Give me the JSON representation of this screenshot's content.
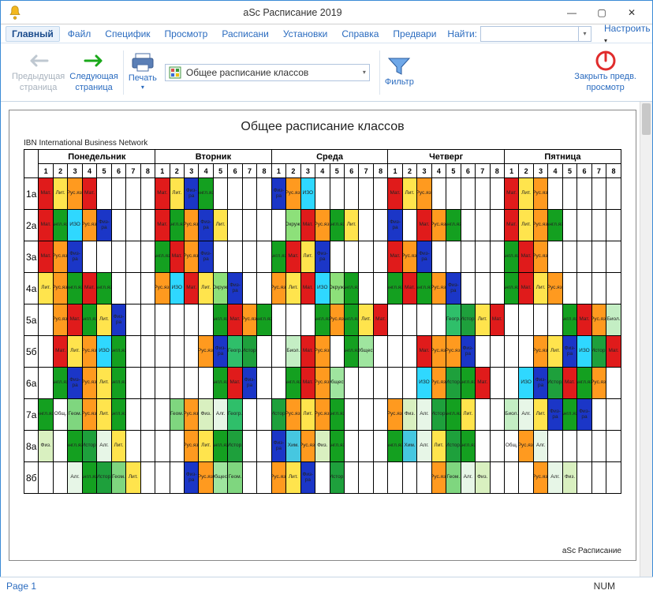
{
  "app_title": "aSc Расписание 2019",
  "window": {
    "min": "—",
    "max": "▢",
    "close": "✕"
  },
  "menu": {
    "items": [
      "Главный",
      "Файл",
      "Специфик",
      "Просмотр",
      "Расписани",
      "Установки",
      "Справка",
      "Предвари"
    ],
    "active": "Главный",
    "find_label": "Найти:",
    "settings": "Настроить"
  },
  "ribbon": {
    "prev": {
      "line1": "Предыдущая",
      "line2": "страница"
    },
    "next": {
      "line1": "Следующая",
      "line2": "страница"
    },
    "print": "Печать",
    "combo": "Общее расписание классов",
    "filter": "Фильтр",
    "close": {
      "line1": "Закрыть предв.",
      "line2": "просмотр"
    }
  },
  "preview": {
    "title": "Общее расписание классов",
    "org": "IBN International Business Network",
    "days": [
      "Понедельник",
      "Вторник",
      "Среда",
      "Четверг",
      "Пятница"
    ],
    "periods": [
      "1",
      "2",
      "3",
      "4",
      "5",
      "6",
      "7",
      "8"
    ],
    "classes": [
      "1а",
      "2а",
      "3а",
      "4а",
      "5а",
      "5б",
      "6а",
      "7а",
      "8а",
      "8б"
    ],
    "footer": "aSc Расписание"
  },
  "chart_data": {
    "type": "table",
    "title": "Общее расписание классов",
    "days": [
      "Понедельник",
      "Вторник",
      "Среда",
      "Четверг",
      "Пятница"
    ],
    "periods_per_day": 8,
    "classes": [
      "1а",
      "2а",
      "3а",
      "4а",
      "5а",
      "5б",
      "6а",
      "7а",
      "8а",
      "8б"
    ],
    "legend_colors": {
      "Мат.": "#e01b1b",
      "Рус.яз.": "#ff9a1f",
      "Лит.": "#ffe44d",
      "Англ.яз.": "#14a020",
      "Физ-ра": "#1b36c7",
      "ИЗО": "#2fd8ff",
      "Окруж.": "#8de07a",
      "Информ.": "#0d8a46",
      "Геогр.": "#2fbf6a",
      "Истор.": "#1ea03c",
      "Биол.": "#c4eec4",
      "Общест.": "#9fe59f",
      "МХК": "#4bbff0",
      "Физ.": "#d9f0c0",
      "Хим.": "#46c7e0",
      "Геом.": "#7fd67f",
      "Алг.": "#e7f6e7"
    },
    "cells": {
      "1а": {
        "Понедельник": [
          "Мат.",
          "Лит.",
          "Рус.яз.",
          "Мат.",
          "",
          "",
          "",
          ""
        ],
        "Вторник": [
          "Мат.",
          "Лит.",
          "Физ-ра",
          "Англ.яз.",
          "",
          "",
          "",
          ""
        ],
        "Среда": [
          "Физ-ра",
          "Рус.яз.",
          "ИЗО",
          "",
          "",
          "",
          "",
          ""
        ],
        "Четверг": [
          "Мат.",
          "Лит.",
          "Рус.яз.",
          "",
          "",
          "",
          "",
          ""
        ],
        "Пятница": [
          "Мат.",
          "Лит.",
          "Рус.яз.",
          "",
          "",
          "",
          "",
          ""
        ]
      },
      "2а": {
        "Понедельник": [
          "Мат.",
          "Англ.яз.",
          "ИЗО",
          "Рус.яз.",
          "Физ-ра",
          "",
          "",
          ""
        ],
        "Вторник": [
          "Мат.",
          "Англ.яз.",
          "Рус.яз.",
          "Физ-ра",
          "Лит.",
          "",
          "",
          ""
        ],
        "Среда": [
          "",
          "Окруж.",
          "Мат.",
          "Рус.яз.",
          "Англ.яз.",
          "Лит.",
          "",
          ""
        ],
        "Четверг": [
          "Физ-ра",
          "",
          "Мат.",
          "Рус.яз.",
          "Англ.яз.",
          "",
          "",
          ""
        ],
        "Пятница": [
          "Мат.",
          "Лит.",
          "Рус.яз.",
          "Англ.яз.",
          "",
          "",
          "",
          ""
        ]
      },
      "3а": {
        "Понедельник": [
          "Мат.",
          "Рус.яз.",
          "Физ-ра",
          "",
          "",
          "",
          "",
          ""
        ],
        "Вторник": [
          "Англ.яз.",
          "Мат.",
          "Рус.яз.",
          "Физ-ра",
          "",
          "",
          "",
          ""
        ],
        "Среда": [
          "Англ.яз.",
          "Мат.",
          "Лит.",
          "Физ-ра",
          "",
          "",
          "",
          ""
        ],
        "Четверг": [
          "Мат.",
          "Рус.яз.",
          "Физ-ра",
          "",
          "",
          "",
          "",
          ""
        ],
        "Пятница": [
          "Англ.яз.",
          "Мат.",
          "Рус.яз.",
          "",
          "",
          "",
          "",
          ""
        ]
      },
      "4а": {
        "Понедельник": [
          "Лит.",
          "Рус.яз.",
          "Англ.яз.",
          "Мат.",
          "Англ.яз.",
          "",
          "",
          ""
        ],
        "Вторник": [
          "Рус.яз.",
          "ИЗО",
          "Мат.",
          "Лит.",
          "Окруж.",
          "Физ-ра",
          "",
          ""
        ],
        "Среда": [
          "Рус.яз.",
          "Лит.",
          "Мат.",
          "ИЗО",
          "Окруж.",
          "Англ.яз.",
          "",
          ""
        ],
        "Четверг": [
          "Англ.яз.",
          "Мат.",
          "Англ.яз.",
          "Рус.яз.",
          "Физ-ра",
          "",
          "",
          ""
        ],
        "Пятница": [
          "Англ.яз.",
          "Мат.",
          "Лит.",
          "Рус.яз.",
          "",
          "",
          "",
          ""
        ]
      },
      "5а": {
        "Понедельник": [
          "",
          "Рус.яз.",
          "Мат.",
          "Англ.яз.",
          "Лит.",
          "Физ-ра",
          "",
          ""
        ],
        "Вторник": [
          "",
          "",
          "",
          "",
          "Англ.яз.",
          "Мат.",
          "Рус.яз.",
          "Англ.яз."
        ],
        "Среда": [
          "",
          "",
          "",
          "Англ.яз.",
          "Рус.яз.",
          "Англ.яз.",
          "Лит.",
          "Мат."
        ],
        "Четверг": [
          "",
          "",
          "",
          "",
          "Геогр.",
          "Истор.",
          "Лит.",
          "Мат."
        ],
        "Пятница": [
          "",
          "",
          "",
          "",
          "Англ.яз.",
          "Мат.",
          "Рус.яз.",
          "Биол."
        ]
      },
      "5б": {
        "Понедельник": [
          "",
          "Мат.",
          "Лит.",
          "Рус.яз.",
          "ИЗО",
          "Англ.яз.",
          "",
          ""
        ],
        "Вторник": [
          "",
          "",
          "",
          "Рус.яз.",
          "Физ-ра",
          "Геогр.",
          "Истор.",
          ""
        ],
        "Среда": [
          "",
          "Биол.",
          "Мат.",
          "Рус.яз.",
          "",
          "Англ.яз.",
          "Общест.",
          ""
        ],
        "Четверг": [
          "",
          "",
          "Мат.",
          "Рус.яз.",
          "Рус.яз.",
          "Физ-ра",
          "",
          ""
        ],
        "Пятница": [
          "",
          "",
          "Рус.яз.",
          "Лит.",
          "Физ-ра",
          "ИЗО",
          "Истор.",
          "Мат."
        ]
      },
      "6а": {
        "Понедельник": [
          "",
          "Англ.яз.",
          "Физ-ра",
          "Рус.яз.",
          "Лит.",
          "Англ.яз.",
          "",
          ""
        ],
        "Вторник": [
          "",
          "",
          "",
          "",
          "Англ.яз.",
          "Мат.",
          "Физ-ра",
          ""
        ],
        "Среда": [
          "",
          "Англ.яз.",
          "Мат.",
          "Рус.яз.",
          "Общест.",
          "",
          "",
          ""
        ],
        "Четверг": [
          "",
          "",
          "ИЗО",
          "Рус.яз.",
          "Истор.",
          "Англ.яз.",
          "Мат.",
          ""
        ],
        "Пятница": [
          "",
          "ИЗО",
          "Физ-ра",
          "Истор.",
          "Мат.",
          "Англ.яз.",
          "Рус.яз.",
          ""
        ]
      },
      "7а": {
        "Понедельник": [
          "Англ.яз.",
          "Общ.",
          "Геом.",
          "Рус.яз.",
          "Лит.",
          "Англ.яз.",
          "",
          ""
        ],
        "Вторник": [
          "",
          "Геом.",
          "Рус.яз.",
          "Физ.",
          "Алг.",
          "Геогр.",
          "",
          ""
        ],
        "Среда": [
          "Истор.",
          "Рус.яз.",
          "Лит.",
          "Рус.яз.",
          "Англ.яз.",
          "",
          "",
          ""
        ],
        "Четверг": [
          "Рус.яз.",
          "Физ.",
          "Алг.",
          "Истор.",
          "Англ.яз.",
          "Лит.",
          "",
          ""
        ],
        "Пятница": [
          "Биол.",
          "Алг.",
          "Лит.",
          "Физ-ра",
          "Англ.яз.",
          "Физ-ра",
          "",
          ""
        ]
      },
      "8а": {
        "Понедельник": [
          "Физ.",
          "",
          "Англ.яз.",
          "Истор.",
          "Алг.",
          "Лит.",
          "",
          ""
        ],
        "Вторник": [
          "",
          "",
          "Рус.яз.",
          "Лит.",
          "Англ.яз.",
          "Истор.",
          "",
          ""
        ],
        "Среда": [
          "Физ-ра",
          "Хим.",
          "Рус.яз.",
          "Физ.",
          "Англ.яз.",
          "",
          "",
          ""
        ],
        "Четверг": [
          "Англ.яз.",
          "Хим.",
          "Алг.",
          "Лит.",
          "Истор.",
          "Англ.яз.",
          "",
          ""
        ],
        "Пятница": [
          "Общ.",
          "Рус.яз.",
          "Алг.",
          "",
          "",
          "",
          "",
          ""
        ]
      },
      "8б": {
        "Понедельник": [
          "",
          "",
          "Алг.",
          "Англ.яз.",
          "Истор.",
          "Геом.",
          "Лит.",
          ""
        ],
        "Вторник": [
          "",
          "",
          "Физ-ра",
          "Рус.яз.",
          "Общест.",
          "Геом.",
          "",
          ""
        ],
        "Среда": [
          "Рус.яз.",
          "Лит.",
          "Физ-ра",
          "",
          "Истор.",
          "",
          "",
          ""
        ],
        "Четверг": [
          "",
          "",
          "",
          "Рус.яз.",
          "Геом.",
          "Алг.",
          "Физ.",
          ""
        ],
        "Пятница": [
          "",
          "",
          "Рус.яз.",
          "Алг.",
          "Физ.",
          "",
          "",
          ""
        ]
      }
    }
  },
  "status": {
    "page": "Page 1",
    "num": "NUM"
  }
}
